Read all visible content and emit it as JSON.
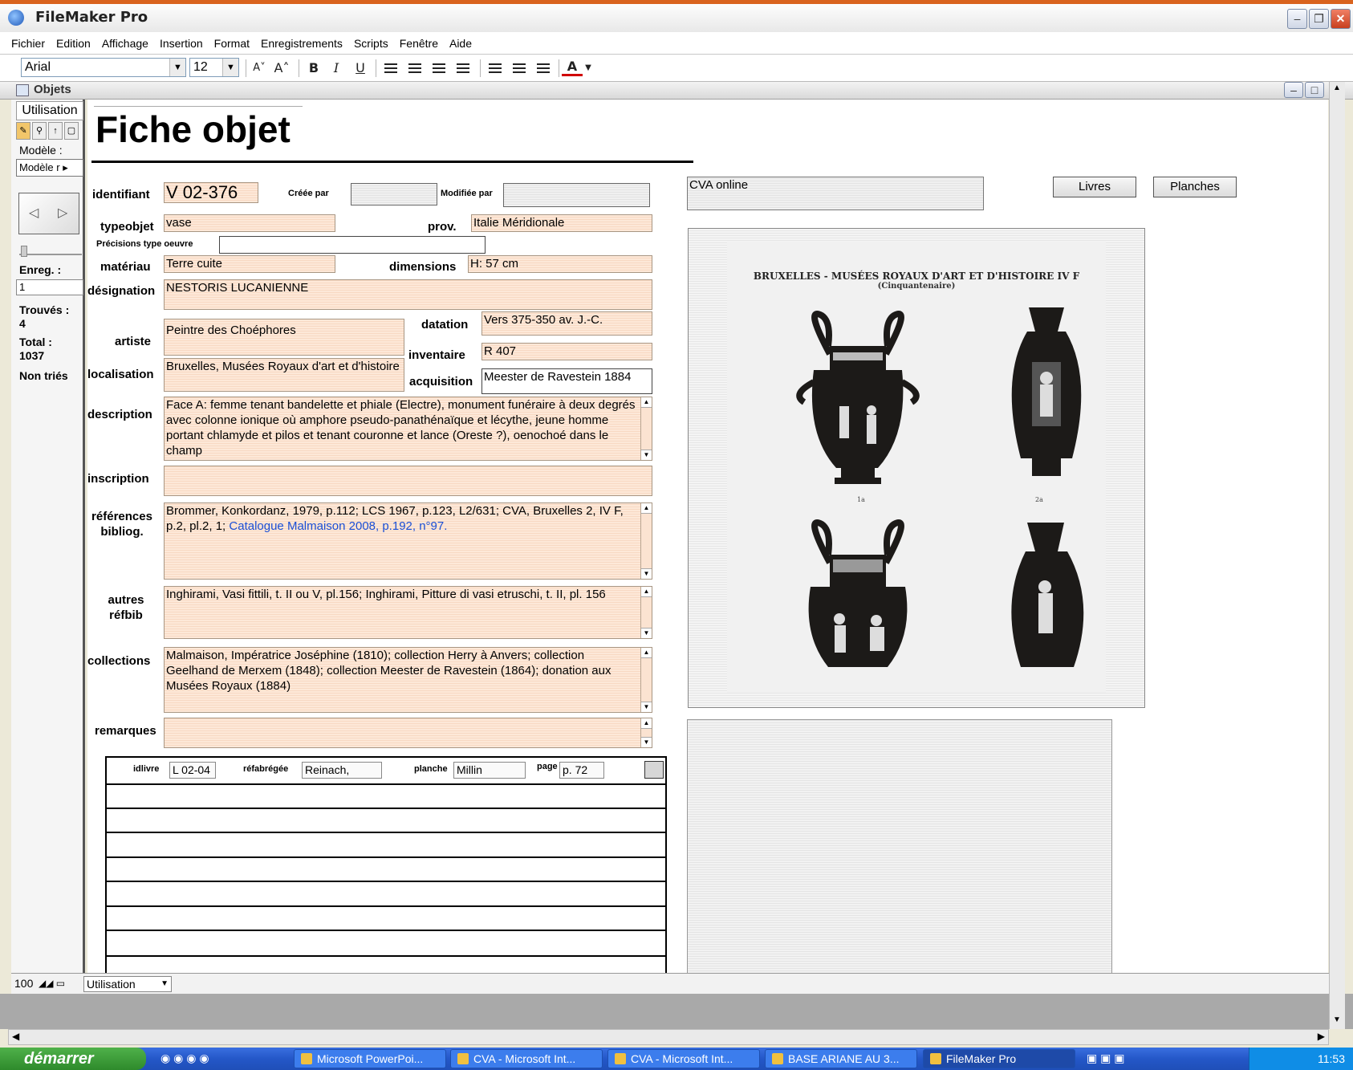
{
  "window": {
    "title": "FileMaker Pro"
  },
  "menu": [
    "Fichier",
    "Edition",
    "Affichage",
    "Insertion",
    "Format",
    "Enregistrements",
    "Scripts",
    "Fenêtre",
    "Aide"
  ],
  "toolbar": {
    "font": "Arial",
    "size": "12"
  },
  "inner_window": {
    "title": "Objets"
  },
  "status": {
    "mode": "Utilisation",
    "layout_label": "Modèle :",
    "layout_value": "Modèle r",
    "record_label": "Enreg. :",
    "record_value": "1",
    "found_label": "Trouvés :",
    "found_value": "4",
    "total_label": "Total :",
    "total_value": "1037",
    "sort_status": "Non triés"
  },
  "form": {
    "title": "Fiche objet",
    "labels": {
      "identifiant": "identifiant",
      "creee_par": "Créée par",
      "modifiee_par": "Modifiée par",
      "typeobjet": "typeobjet",
      "prov": "prov.",
      "precisions": "Précisions type oeuvre",
      "materiau": "matériau",
      "dimensions": "dimensions",
      "designation": "désignation",
      "datation": "datation",
      "artiste": "artiste",
      "inventaire": "inventaire",
      "localisation": "localisation",
      "acquisition": "acquisition",
      "description": "description",
      "inscription": "inscription",
      "references": "références bibliog.",
      "autres": "autres réfbib",
      "collections": "collections",
      "remarques": "remarques"
    },
    "values": {
      "identifiant": "V 02-376",
      "creee_par": "",
      "modifiee_par": "",
      "typeobjet": "vase",
      "prov": "Italie Méridionale",
      "precisions": "",
      "materiau": "Terre cuite",
      "dimensions": "H: 57 cm",
      "designation": "NESTORIS LUCANIENNE",
      "datation": "Vers 375-350 av. J.-C.",
      "artiste": "Peintre des Choéphores",
      "inventaire": "R 407",
      "localisation": "Bruxelles, Musées Royaux d'art et d'histoire",
      "acquisition": "Meester de Ravestein 1884",
      "description": "Face A: femme tenant bandelette et phiale (Electre), monument funéraire à deux degrés avec colonne ionique où amphore pseudo-panathénaïque et lécythe, jeune homme portant chlamyde et pilos et tenant couronne et lance (Oreste ?), oenochoé dans le champ",
      "inscription": "",
      "references": "Brommer, Konkordanz, 1979, p.112; LCS 1967, p.123, L2/631; CVA, Bruxelles 2, IV F, p.2, pl.2, 1; ",
      "references_link": "Catalogue Malmaison 2008, p.192, n°97.",
      "autres": "Inghirami, Vasi fittili, t. II ou V, pl.156; Inghirami, Pitture di vasi etruschi, t. II, pl. 156",
      "collections": "Malmaison, Impératrice  Joséphine (1810); collection Herry à Anvers; collection Geelhand de Merxem (1848); collection Meester de Ravestein (1864); donation aux Musées Royaux (1884)",
      "remarques": ""
    },
    "cva_online": "CVA online",
    "buttons": {
      "livres": "Livres",
      "planches": "Planches"
    },
    "plate": {
      "caption": "BRUXELLES - MUSÉES ROYAUX D'ART ET D'HISTOIRE  IV F",
      "subcaption": "(Cinquantenaire)",
      "labels": [
        "1a",
        "2a"
      ]
    },
    "portal": {
      "labels": {
        "idlivre": "idlivre",
        "refabregee": "réfabrégée",
        "planche": "planche",
        "page": "page"
      },
      "row": {
        "idlivre": "L 02-04",
        "refabregee": "Reinach,",
        "planche": "Millin",
        "page": "p. 72"
      }
    }
  },
  "bottom": {
    "zoom": "100",
    "mode": "Utilisation"
  },
  "taskbar": {
    "start": "démarrer",
    "tasks": [
      "Microsoft PowerPoi...",
      "CVA - Microsoft Int...",
      "CVA - Microsoft Int...",
      "BASE ARIANE AU 3...",
      "FileMaker Pro"
    ],
    "clock": "11:53"
  }
}
